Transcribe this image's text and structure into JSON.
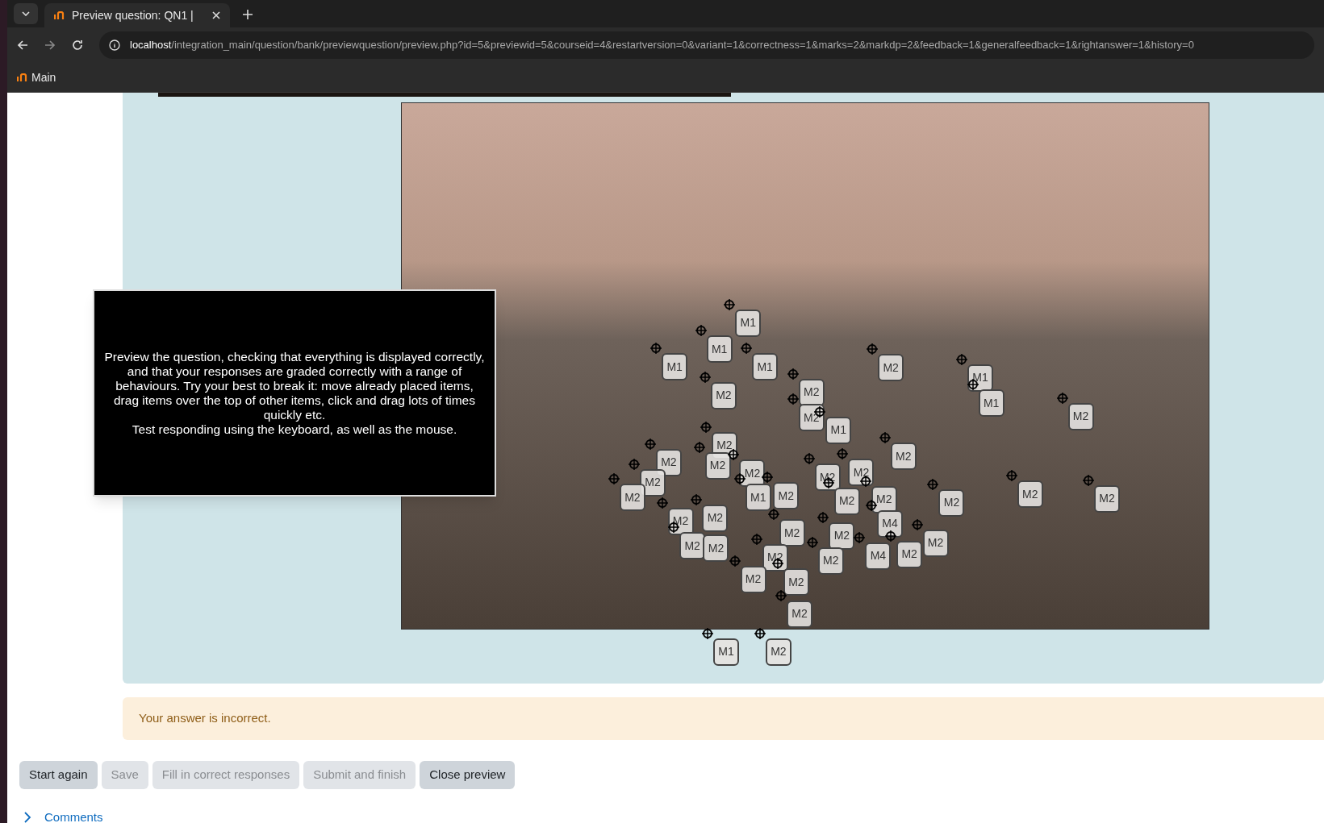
{
  "browser": {
    "tab_title": "Preview question: QN1 |",
    "url_host": "localhost",
    "url_path": "/integration_main/question/bank/previewquestion/preview.php?id=5&previewid=5&courseid=4&restartversion=0&variant=1&correctness=1&marks=2&markdp=2&feedback=1&generalfeedback=1&rightanswer=1&history=0",
    "bookmarks": [
      {
        "label": "Main"
      }
    ]
  },
  "tooltip": {
    "paragraphs": [
      "Preview the question, checking that everything is displayed correctly, and that your responses are graded correctly with a range of behaviours. Try your best to break it: move already placed items, drag items over the top of other items, click and drag lots of times quickly etc.",
      "Test responding using the keyboard, as well as the mouse."
    ]
  },
  "markers": [
    {
      "label": "M1"
    },
    {
      "label": "M1"
    },
    {
      "label": "M1"
    },
    {
      "label": "M1"
    },
    {
      "label": "M2"
    },
    {
      "label": "M1"
    },
    {
      "label": "M1"
    },
    {
      "label": "M2"
    },
    {
      "label": "M2"
    },
    {
      "label": "M2"
    },
    {
      "label": "M2"
    },
    {
      "label": "M1"
    },
    {
      "label": "M2"
    },
    {
      "label": "M2"
    },
    {
      "label": "M2"
    },
    {
      "label": "M2"
    },
    {
      "label": "M2"
    },
    {
      "label": "M2"
    },
    {
      "label": "M2"
    },
    {
      "label": "M1"
    },
    {
      "label": "M2"
    },
    {
      "label": "M2"
    },
    {
      "label": "M2"
    },
    {
      "label": "M2"
    },
    {
      "label": "M2"
    },
    {
      "label": "M2"
    },
    {
      "label": "M2"
    },
    {
      "label": "M2"
    },
    {
      "label": "M2"
    },
    {
      "label": "M2"
    },
    {
      "label": "M2"
    },
    {
      "label": "M2"
    },
    {
      "label": "M2"
    },
    {
      "label": "M2"
    },
    {
      "label": "M4"
    },
    {
      "label": "M2"
    },
    {
      "label": "M4"
    },
    {
      "label": "M2"
    },
    {
      "label": "M2"
    },
    {
      "label": "M2"
    },
    {
      "label": "M2"
    },
    {
      "label": "M2"
    },
    {
      "label": "M2"
    },
    {
      "label": "M1"
    },
    {
      "label": "M2"
    }
  ],
  "feedback": "Your answer is incorrect.",
  "buttons": [
    {
      "label": "Start again",
      "disabled": false
    },
    {
      "label": "Save",
      "disabled": true
    },
    {
      "label": "Fill in correct responses",
      "disabled": true
    },
    {
      "label": "Submit and finish",
      "disabled": true
    },
    {
      "label": "Close preview",
      "disabled": false
    }
  ],
  "comments": {
    "label": "Comments",
    "expanded": false
  }
}
